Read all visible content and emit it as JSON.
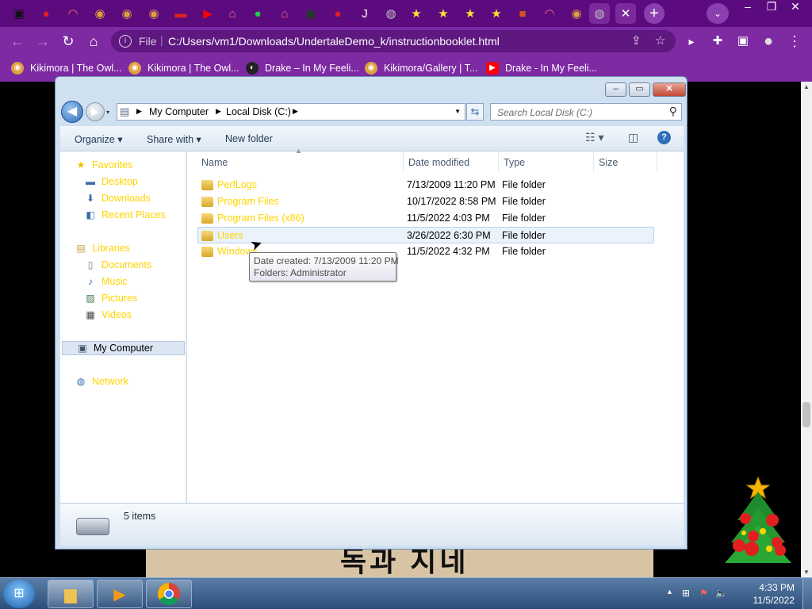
{
  "browser": {
    "tabs": [
      {
        "icon": "undertale-tab-icon",
        "glyph": "▣",
        "color": "#111111"
      },
      {
        "icon": "mario-tab-icon",
        "glyph": "●",
        "color": "#e02020"
      },
      {
        "icon": "rainbow-tab-icon",
        "glyph": "◠",
        "color": "#ff6b6b"
      },
      {
        "icon": "owl-tab-icon",
        "glyph": "◉",
        "color": "#e0a040"
      },
      {
        "icon": "owl-tab-icon",
        "glyph": "◉",
        "color": "#e0a040"
      },
      {
        "icon": "owl-tab-icon",
        "glyph": "◉",
        "color": "#e0a040"
      },
      {
        "icon": "red-badge-tab-icon",
        "glyph": "▬",
        "color": "#e02020"
      },
      {
        "icon": "youtube-tab-icon",
        "glyph": "▶",
        "color": "#ff0000"
      },
      {
        "icon": "store-tab-icon",
        "glyph": "⌂",
        "color": "#ff6b8b"
      },
      {
        "icon": "green-char-tab-icon",
        "glyph": "●",
        "color": "#22cc44"
      },
      {
        "icon": "store-tab-icon",
        "glyph": "⌂",
        "color": "#ff6b8b"
      },
      {
        "icon": "terminal-tab-icon",
        "glyph": "▣",
        "color": "#204020"
      },
      {
        "icon": "mario-tab-icon",
        "glyph": "●",
        "color": "#e02020"
      },
      {
        "icon": "j-tab-icon",
        "glyph": "J",
        "color": "#ffffff"
      },
      {
        "icon": "globe-tab-icon",
        "glyph": "◍",
        "color": "#c0c0c0"
      },
      {
        "icon": "star-tab-icon",
        "glyph": "★",
        "color": "#ffe033"
      },
      {
        "icon": "star-tab-icon",
        "glyph": "★",
        "color": "#ffe033"
      },
      {
        "icon": "star-tab-icon",
        "glyph": "★",
        "color": "#ffe033"
      },
      {
        "icon": "star-tab-icon",
        "glyph": "★",
        "color": "#ffe033"
      },
      {
        "icon": "mario-sprite-tab-icon",
        "glyph": "■",
        "color": "#d05020"
      },
      {
        "icon": "rainbow-tab-icon",
        "glyph": "◠",
        "color": "#ff6b6b"
      },
      {
        "icon": "owl-tab-icon",
        "glyph": "◉",
        "color": "#e0a040"
      },
      {
        "icon": "globe-tab-icon",
        "glyph": "◍",
        "color": "#c0c0c0"
      }
    ],
    "close_tab_glyph": "✕",
    "new_tab_glyph": "+",
    "tab_search_glyph": "⌄",
    "window_controls": [
      "–",
      "❐",
      "✕"
    ],
    "nav": {
      "back": "←",
      "forward": "→",
      "reload": "↻",
      "home": "⌂"
    },
    "omnibox": {
      "info_glyph": "i",
      "scheme": "File",
      "separator": "|",
      "url": "C:/Users/vm1/Downloads/UndertaleDemo_k/instructionbooklet.html",
      "share_glyph": "⇪",
      "star_glyph": "☆"
    },
    "toolbar_right": {
      "media": "▸",
      "extensions": "✚",
      "sidepanel": "▣",
      "profile": "●",
      "menu": "⋮"
    },
    "bookmarks": [
      {
        "label": "Kikimora | The Owl...",
        "icon": "owl-bookmark-icon",
        "glyph": "◉",
        "color": "#e0a040"
      },
      {
        "label": "Kikimora | The Owl...",
        "icon": "owl-bookmark-icon",
        "glyph": "◉",
        "color": "#e0a040"
      },
      {
        "label": "Drake – In My Feeli...",
        "icon": "drake-bookmark-icon",
        "glyph": "◐",
        "color": "#222222"
      },
      {
        "label": "Kikimora/Gallery | T...",
        "icon": "owl-bookmark-icon",
        "glyph": "◉",
        "color": "#e0a040"
      },
      {
        "label": "Drake - In My Feeli...",
        "icon": "youtube-bookmark-icon",
        "glyph": "▶",
        "color": "#ff0000"
      }
    ]
  },
  "page": {
    "korean_text": "독과 지네"
  },
  "explorer": {
    "caption": {
      "minimize": "–",
      "maximize": "▭",
      "close": "✕"
    },
    "breadcrumb": [
      "My Computer",
      "Local Disk (C:)"
    ],
    "search_placeholder": "Search Local Disk (C:)",
    "commands": {
      "organize": "Organize ▾",
      "share_with": "Share with ▾",
      "new_folder": "New folder",
      "help": "?"
    },
    "nav_pane": {
      "favorites": {
        "label": "Favorites",
        "items": [
          "Desktop",
          "Downloads",
          "Recent Places"
        ]
      },
      "libraries": {
        "label": "Libraries",
        "items": [
          "Documents",
          "Music",
          "Pictures",
          "Videos"
        ]
      },
      "computer": "My Computer",
      "network": "Network"
    },
    "columns": [
      "Name",
      "Date modified",
      "Type",
      "Size"
    ],
    "files": [
      {
        "name": "PerfLogs",
        "date": "7/13/2009 11:20 PM",
        "type": "File folder"
      },
      {
        "name": "Program Files",
        "date": "10/17/2022 8:58 PM",
        "type": "File folder"
      },
      {
        "name": "Program Files (x86)",
        "date": "11/5/2022 4:03 PM",
        "type": "File folder"
      },
      {
        "name": "Users",
        "date": "3/26/2022 6:30 PM",
        "type": "File folder"
      },
      {
        "name": "Windows",
        "date": "11/5/2022 4:32 PM",
        "type": "File folder"
      }
    ],
    "tooltip": {
      "line1": "Date created: 7/13/2009 11:20 PM",
      "line2": "Folders: Administrator"
    },
    "status": "5 items"
  },
  "taskbar": {
    "clock_time": "4:33 PM",
    "clock_date": "11/5/2022",
    "tray_glyphs": {
      "arrow": "▴",
      "network": "⊞",
      "flag": "⚑",
      "volume": "🔈"
    }
  }
}
